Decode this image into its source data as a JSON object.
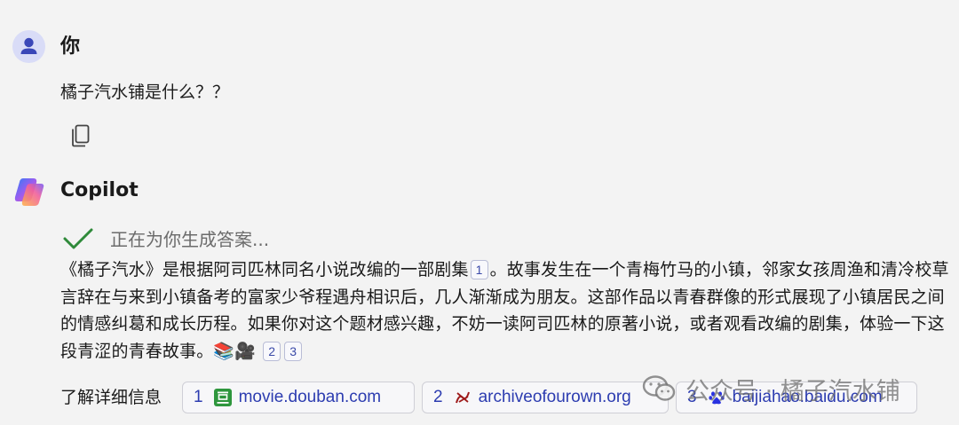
{
  "user": {
    "name": "你",
    "message": "橘子汽水铺是什么？？"
  },
  "copilot": {
    "name": "Copilot",
    "status": "正在为你生成答案..."
  },
  "answer": {
    "p1": "《橘子汽水》是根据阿司匹林同名小说改编的一部剧集",
    "p2": "。故事发生在一个青梅竹马的小镇，邻家女孩周渔和清冷校草言辞在与来到小镇备考的富家少爷程遇舟相识后，几人渐渐成为朋友。这部作品以青春群像的形式展现了小镇居民之间的情感纠葛和成长历程。如果你对这个题材感兴趣，不妨一读阿司匹林的原著小说，或者观看改编的剧集，体验一下这段青涩的青春故事。",
    "emoji": "📚🎥",
    "cites": [
      "1",
      "2",
      "3"
    ]
  },
  "learn_more": {
    "label": "了解详细信息",
    "sources": [
      {
        "num": "1",
        "site": "movie.douban.com",
        "icon": "douban-icon"
      },
      {
        "num": "2",
        "site": "archiveofourown.org",
        "icon": "ao3-icon"
      },
      {
        "num": "3",
        "site": "baijiahao.baidu.com",
        "icon": "baidu-paw-icon"
      }
    ]
  },
  "watermark": {
    "text": "公众号 · 橘子汽水铺"
  },
  "colors": {
    "background": "#f3f3f3",
    "link": "#2c3cb0",
    "check": "#2f8a3a"
  }
}
